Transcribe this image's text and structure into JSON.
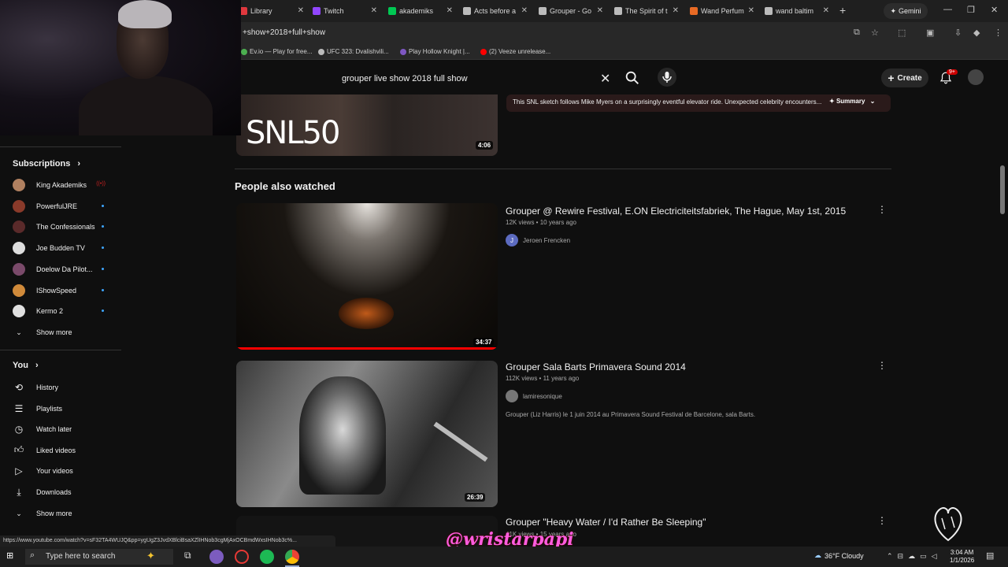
{
  "browser": {
    "tabs": [
      {
        "label": "Library",
        "color": "#e0383e"
      },
      {
        "label": "Twitch",
        "color": "#9146ff"
      },
      {
        "label": "akademiks",
        "color": "#00c853"
      },
      {
        "label": "Acts before a",
        "color": "#bbbbbb"
      },
      {
        "label": "Grouper - Go",
        "color": "#bbbbbb"
      },
      {
        "label": "The Spirit of t",
        "color": "#bbbbbb"
      },
      {
        "label": "Wand Perfum",
        "color": "#e86a24"
      },
      {
        "label": "wand baltim",
        "color": "#bbbbbb"
      }
    ],
    "gemini_label": "Gemini",
    "url": "+show+2018+full+show",
    "bookmarks": [
      {
        "label": "Ev.io — Play for free...",
        "color": "#4caf50"
      },
      {
        "label": "UFC 323: Dvalishvili...",
        "color": "#bbbbbb"
      },
      {
        "label": "Play Hollow Knight |...",
        "color": "#7e57c2"
      },
      {
        "label": "(2) Veeze unrelease...",
        "color": "#ff0000"
      }
    ],
    "status_url": "https://www.youtube.com/watch?v=sF32TA4WUJQ&pp=ygUgZ3JvdXBlciBsaXZlIHNob3cgMjAxOCBmdWxsIHNob3c%..."
  },
  "youtube": {
    "search_query": "grouper live show 2018 full show",
    "create_label": "Create",
    "notification_count": "9+"
  },
  "sidebar": {
    "subscriptions_title": "Subscriptions",
    "subscriptions": [
      {
        "name": "King Akademiks",
        "color": "#b08060",
        "badge": "live"
      },
      {
        "name": "PowerfulJRE",
        "color": "#8a3a2a",
        "badge": "dot"
      },
      {
        "name": "The Confessionals",
        "color": "#5a2a2a",
        "badge": "dot"
      },
      {
        "name": "Joe Budden TV",
        "color": "#dddddd",
        "badge": "dot"
      },
      {
        "name": "Doelow Da Pilot...",
        "color": "#7a4a6a",
        "badge": "dot"
      },
      {
        "name": "IShowSpeed",
        "color": "#d08a3a",
        "badge": "dot"
      },
      {
        "name": "Kermo 2",
        "color": "#e0e0e0",
        "badge": "dot"
      }
    ],
    "show_more_1": "Show more",
    "you_title": "You",
    "you_items": [
      {
        "name": "History",
        "icon": "history-icon"
      },
      {
        "name": "Playlists",
        "icon": "playlists-icon"
      },
      {
        "name": "Watch later",
        "icon": "clock-icon"
      },
      {
        "name": "Liked videos",
        "icon": "thumbs-up-icon"
      },
      {
        "name": "Your videos",
        "icon": "play-square-icon"
      },
      {
        "name": "Downloads",
        "icon": "download-icon"
      }
    ],
    "show_more_2": "Show more"
  },
  "main": {
    "snl_logo": "SNL50",
    "snl_duration": "4:06",
    "summary_text": "This SNL sketch follows Mike Myers on a surprisingly eventful elevator ride. Unexpected celebrity encounters...",
    "summary_button": "Summary",
    "section_title": "People also watched",
    "videos": [
      {
        "title": "Grouper @ Rewire Festival, E.ON Electriciteitsfabriek, The Hague, May 1st, 2015",
        "meta": "12K views • 10 years ago",
        "channel": "Jeroen Frencken",
        "channel_initial": "J",
        "duration": "34:37",
        "description": ""
      },
      {
        "title": "Grouper Sala Barts Primavera Sound 2014",
        "meta": "112K views • 11 years ago",
        "channel": "lamiresonique",
        "channel_initial": "",
        "duration": "26:39",
        "description": "Grouper (Liz Harris) le 1 juin 2014 au Primavera Sound Festival de Barcelone, sala Barts."
      },
      {
        "title": "Grouper \"Heavy Water / I'd Rather Be Sleeping\"",
        "meta": "41K views • 15 years ago",
        "channel": "",
        "channel_initial": "",
        "duration": "",
        "description": ""
      }
    ]
  },
  "overlay": {
    "watermark": "@wristarpapi"
  },
  "taskbar": {
    "search_placeholder": "Type here to search",
    "weather": "36°F  Cloudy",
    "time": "3:04 AM",
    "date": "1/1/2026"
  }
}
